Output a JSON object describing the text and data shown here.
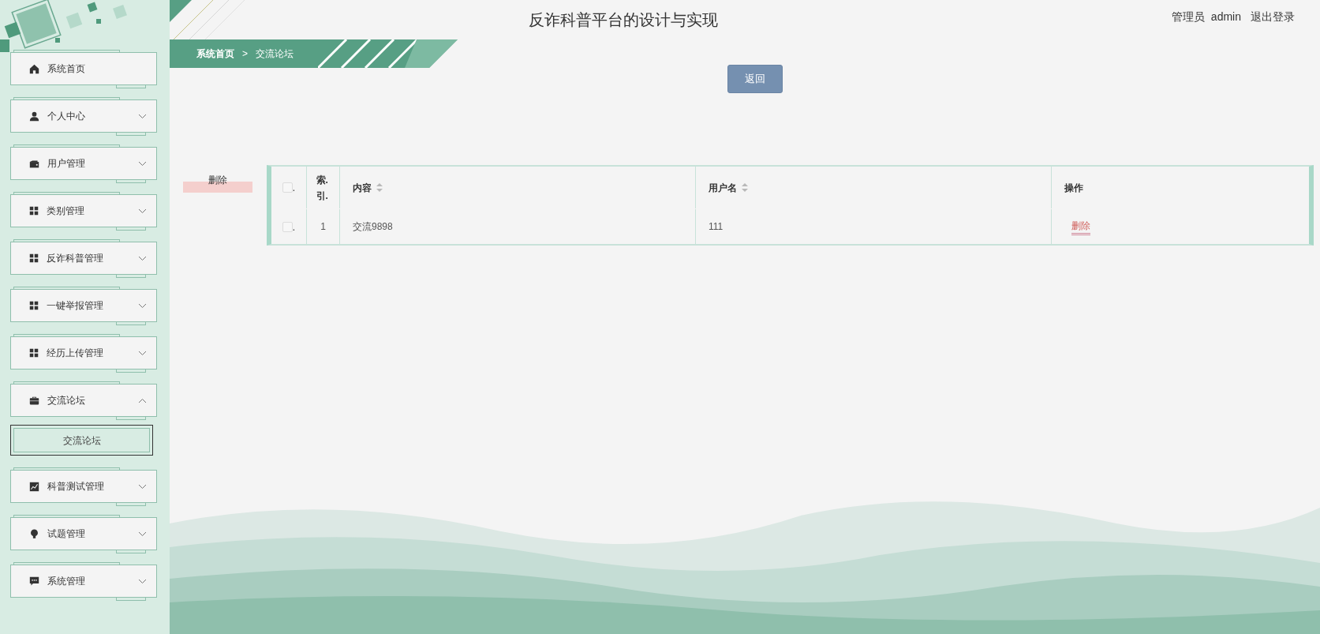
{
  "header": {
    "title": "反诈科普平台的设计与实现",
    "user_role": "管理员",
    "user_name": "admin",
    "logout": "退出登录"
  },
  "sidebar": {
    "items": [
      {
        "label": "系统首页",
        "kind": "home",
        "has_submenu": false
      },
      {
        "label": "个人中心",
        "kind": "person",
        "has_submenu": true,
        "expanded": false
      },
      {
        "label": "用户管理",
        "kind": "wallet",
        "has_submenu": true,
        "expanded": false
      },
      {
        "label": "类别管理",
        "kind": "grid",
        "has_submenu": true,
        "expanded": false
      },
      {
        "label": "反诈科普管理",
        "kind": "grid",
        "has_submenu": true,
        "expanded": false
      },
      {
        "label": "一键举报管理",
        "kind": "grid",
        "has_submenu": true,
        "expanded": false
      },
      {
        "label": "经历上传管理",
        "kind": "grid",
        "has_submenu": true,
        "expanded": false
      },
      {
        "label": "交流论坛",
        "kind": "briefcase",
        "has_submenu": true,
        "expanded": true,
        "children": [
          {
            "label": "交流论坛",
            "selected": true
          }
        ]
      },
      {
        "label": "科普测试管理",
        "kind": "chart",
        "has_submenu": true,
        "expanded": false
      },
      {
        "label": "试题管理",
        "kind": "bulb",
        "has_submenu": true,
        "expanded": false
      },
      {
        "label": "系统管理",
        "kind": "chat",
        "has_submenu": true,
        "expanded": false
      }
    ]
  },
  "breadcrumb": {
    "items": [
      "系统首页",
      "交流论坛"
    ],
    "separator": ">"
  },
  "back_button": "返回",
  "delete_button": "删除",
  "table": {
    "select_all": {
      "checked": false,
      "mark": "."
    },
    "columns": [
      {
        "label": "索.引.",
        "kind": "plain"
      },
      {
        "label": "内容",
        "kind": "sortable"
      },
      {
        "label": "用户名",
        "kind": "sortable"
      },
      {
        "label": "操作",
        "kind": "plain"
      }
    ],
    "rows": [
      {
        "selected": false,
        "mark": ".",
        "index": "1",
        "content": "交流9898",
        "username": "111",
        "action": "删除"
      }
    ]
  }
}
